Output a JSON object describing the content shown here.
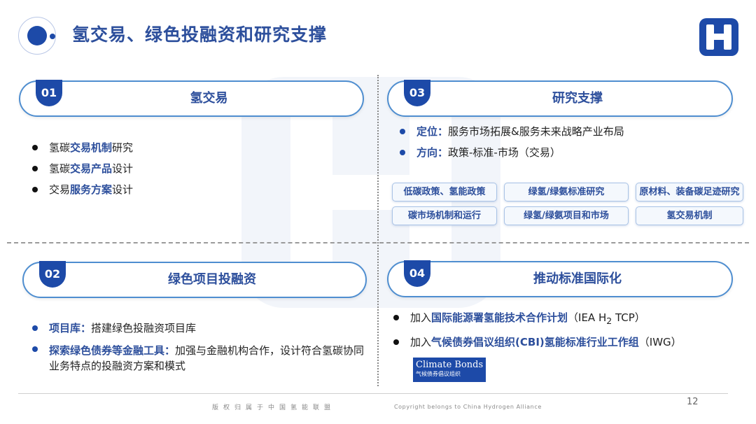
{
  "title": "氢交易、绿色投融资和研究支撑",
  "sections": [
    {
      "num": "01",
      "title": "氢交易",
      "items": [
        {
          "pre": "氢碳",
          "hl": "交易机制",
          "post": "研究"
        },
        {
          "pre": "氢碳",
          "hl": "交易产品",
          "post": "设计"
        },
        {
          "pre": "交易",
          "hl": "服务方案",
          "post": "设计"
        }
      ]
    },
    {
      "num": "02",
      "title": "绿色项目投融资",
      "items": [
        {
          "lead": "项目库：",
          "text": "搭建绿色投融资项目库"
        },
        {
          "lead": "探索绿色债券等金融工具：",
          "text": "加强与金融机构合作，设计符合氢碳协同业务特点的投融资方案和模式"
        }
      ]
    },
    {
      "num": "03",
      "title": "研究支撑",
      "items": [
        {
          "lead": "定位：",
          "text": "服务市场拓展&服务未来战略产业布局"
        },
        {
          "lead": "方向：",
          "text": "政策-标准-市场（交易）"
        }
      ],
      "tags": [
        "低碳政策、氢能政策",
        "绿氢/绿氨标准研究",
        "原材料、装备碳足迹研究",
        "碳市场机制和运行",
        "绿氢/绿氨项目和市场",
        "氢交易机制"
      ]
    },
    {
      "num": "04",
      "title": "推动标准国际化",
      "items": [
        {
          "pre": "加入",
          "hl": "国际能源署氢能技术合作计划",
          "post": "（IEA H",
          "sub": "2",
          "post2": " TCP）"
        },
        {
          "pre": "加入",
          "hl": "气候债券倡议组织(CBI)氢能标准行业工作组",
          "post": "（IWG）"
        }
      ]
    }
  ],
  "climate_bonds": {
    "name": "Climate Bonds",
    "cn": "气候债券倡议组织"
  },
  "footer": {
    "cn": "版权归属于中国氢能联盟",
    "en": "Copyright belongs to China Hydrogen Alliance",
    "page": "12"
  },
  "colors": {
    "primary": "#1d4aa8",
    "accent": "#2d4f9c",
    "pill_border": "#4f8ed0"
  }
}
